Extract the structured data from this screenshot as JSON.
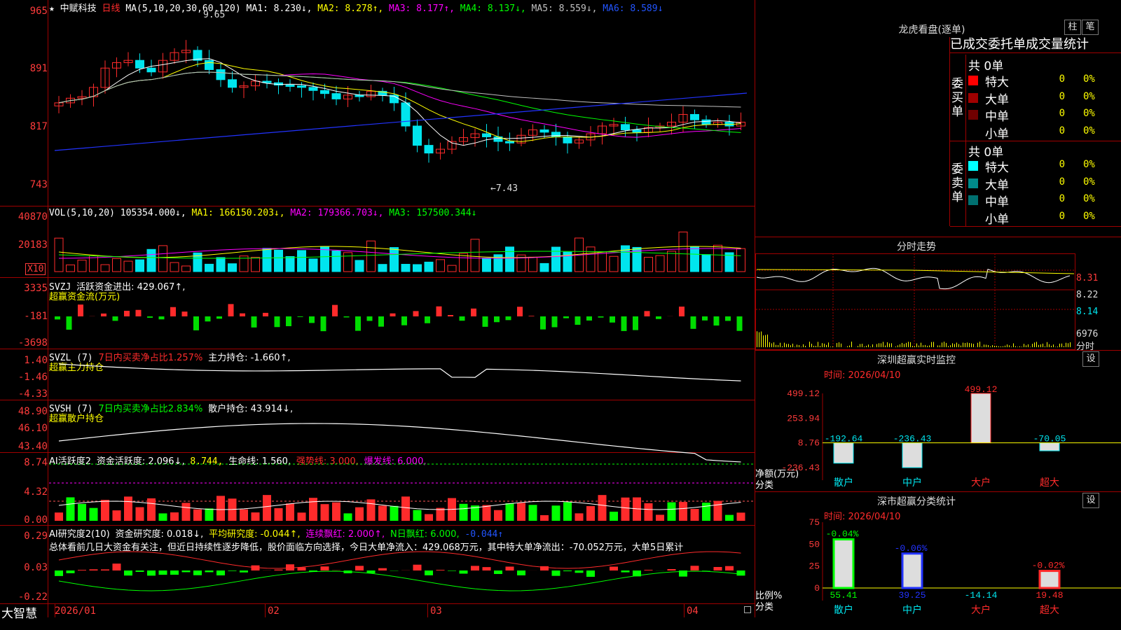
{
  "header": {
    "star": "★",
    "stock_name": "中赋科技",
    "period": "日线",
    "ma_def": "MA(5,10,20,30,60,120)",
    "ma1": "MA1: 8.230↓,",
    "ma2": "MA2: 8.278↑,",
    "ma3": "MA3: 8.177↑,",
    "ma4": "MA4: 8.137↓,",
    "ma5": "MA5: 8.559↓,",
    "ma6": "MA6: 8.589↓"
  },
  "colors": {
    "up": "#ff2b2b",
    "down": "#00e5ee",
    "ma1": "#ffffff",
    "ma2": "#ffff00",
    "ma3": "#ff00ff",
    "ma4": "#00ff00",
    "ma5": "#c0c0c0",
    "ma6": "#2233ff",
    "grid": "#a00000",
    "axis": "#ff3b3b"
  },
  "price_axis": {
    "t1": "965",
    "t2": "891",
    "t3": "817",
    "t4": "743",
    "high_mark": "9.65",
    "low_mark": "←7.43"
  },
  "vol": {
    "def": "VOL(5,10,20)",
    "val": "105354.000↓,",
    "ma1": "MA1: 166150.203↓,",
    "ma2": "MA2: 179366.703↓,",
    "ma3": "MA3: 157500.344↓",
    "t1": "40870",
    "t2": "20183",
    "unit": "X10"
  },
  "svzj": {
    "def": "SVZJ",
    "label": "活跃资金进出: 429.067↑,",
    "sub": "超赢资金流(万元)",
    "t1": "3335",
    "t2": "-181",
    "t3": "-3698"
  },
  "svzl": {
    "def": "SVZL (7)",
    "ratio": "7日内买卖净占比1.257%",
    "hold": "主力持仓: -1.660↑,",
    "sub": "超赢主力持仓",
    "t1": "1.40",
    "t2": "-1.46",
    "t3": "-4.33"
  },
  "svsh": {
    "def": "SVSH (7)",
    "ratio": "7日内买卖净占比2.834%",
    "hold": "散户持仓: 43.914↓,",
    "sub": "超赢散户持仓",
    "t1": "48.90",
    "t2": "46.10",
    "t3": "43.40"
  },
  "ai1": {
    "def": "AI活跃度2",
    "act": "资金活跃度: 2.096↓,",
    "v2": "8.744,",
    "life": "生命线: 1.560,",
    "strong": "强势线: 3.000,",
    "burst": "爆发线: 6.000,",
    "t1": "8.74",
    "t2": "4.32",
    "t3": "0.00"
  },
  "ai2": {
    "def": "AI研究度2(10)",
    "res": "资金研究度: 0.018↓,",
    "avg": "平均研究度: -0.044↑,",
    "red": "连续飘红: 2.000↑,",
    "nred": "N日飘红: 6.000,",
    "last": "-0.044↑",
    "summary": "总体看前几日大资金有关注，但近日持续性逐步降低，股价面临方向选择，今日大单净流入：429.068万元，其中特大单净流出：-70.052万元，大单5日累计",
    "t1": "0.29",
    "t2": "0.03",
    "t3": "-0.22"
  },
  "date_axis": {
    "d1": "2026/01",
    "d2": "02",
    "d3": "03",
    "d4": "04"
  },
  "logo": "大智慧",
  "longhu": {
    "title": "龙虎看盘(逐单)",
    "btn1": "柱",
    "btn2": "笔",
    "stat_title": "已成交委托单成交量统计",
    "buy": {
      "total": "共 0单",
      "side": "委买单",
      "rows": [
        {
          "label": "特大",
          "count": "0",
          "pct": "0%",
          "color": "#ff0000"
        },
        {
          "label": "大单",
          "count": "0",
          "pct": "0%",
          "color": "#a00000"
        },
        {
          "label": "中单",
          "count": "0",
          "pct": "0%",
          "color": "#700000"
        },
        {
          "label": "小单",
          "count": "0",
          "pct": "0%",
          "color": ""
        }
      ]
    },
    "sell": {
      "total": "共 0单",
      "side": "委卖单",
      "rows": [
        {
          "label": "特大",
          "count": "0",
          "pct": "0%",
          "color": "#00ffff"
        },
        {
          "label": "大单",
          "count": "0",
          "pct": "0%",
          "color": "#008b8b"
        },
        {
          "label": "中单",
          "count": "0",
          "pct": "0%",
          "color": "#007070"
        },
        {
          "label": "小单",
          "count": "0",
          "pct": "0%",
          "color": ""
        }
      ]
    }
  },
  "intraday": {
    "title": "分时走势",
    "t1": "8.31",
    "t2": "8.22",
    "t3": "8.14",
    "vol": "6976",
    "fen": "分时"
  },
  "sz_monitor": {
    "title": "深圳超赢实时监控",
    "btn": "设",
    "time": "时间: 2026/04/10",
    "axis": [
      "499.12",
      "253.94",
      "8.76",
      "-236.43"
    ],
    "ylabel": "净额(万元)",
    "xlabel": "分类",
    "chart_data": {
      "type": "bar",
      "categories": [
        "散户",
        "中户",
        "大户",
        "超大"
      ],
      "values": [
        -192.64,
        -236.43,
        499.12,
        -70.05
      ],
      "ylim": [
        -236.43,
        499.12
      ],
      "value_labels": [
        "-192.64",
        "-236.43",
        "499.12",
        "-70.05"
      ]
    }
  },
  "sz_class": {
    "title": "深市超赢分类统计",
    "btn": "设",
    "time": "时间: 2026/04/10",
    "axis": [
      "75",
      "50",
      "25",
      "0"
    ],
    "ylabel": "比例%",
    "xlabel": "分类",
    "chart_data": {
      "type": "bar",
      "categories": [
        "散户",
        "中户",
        "大户",
        "超大"
      ],
      "values": [
        55.41,
        39.25,
        -14.14,
        19.48
      ],
      "changes": [
        "-0.04%",
        "-0.06%",
        "",
        "-0.02%"
      ],
      "value_labels": [
        "55.41",
        "39.25",
        "-14.14",
        "19.48"
      ],
      "ylim": [
        0,
        75
      ]
    }
  }
}
